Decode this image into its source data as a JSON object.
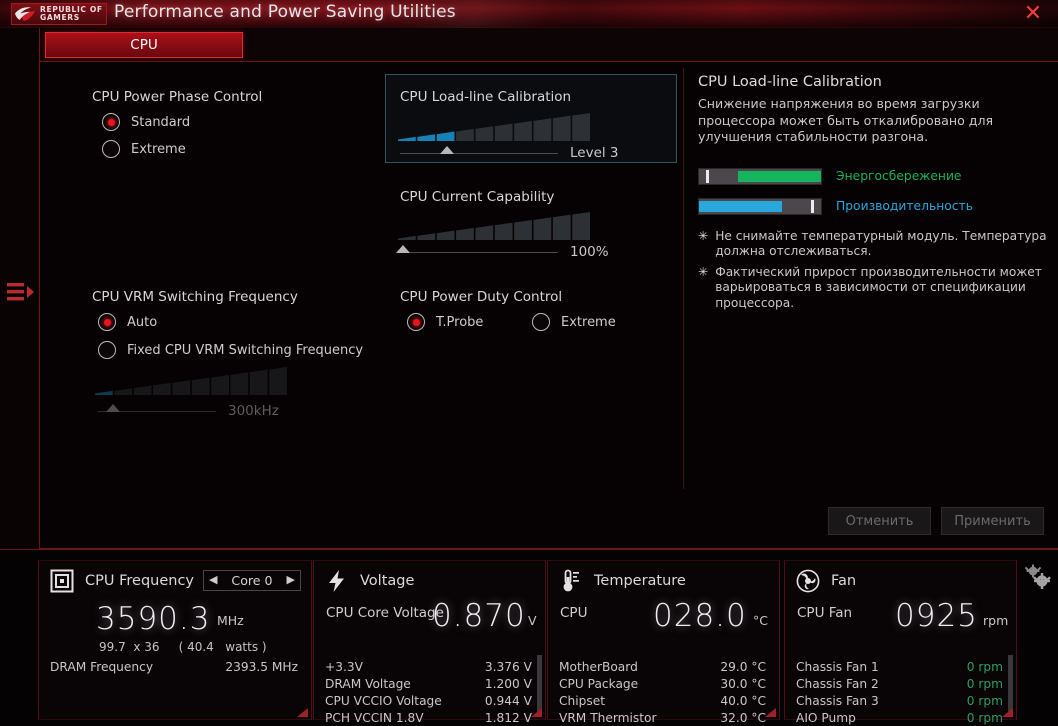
{
  "window": {
    "brand_line1": "REPUBLIC OF",
    "brand_line2": "GAMERS",
    "title": "Performance and Power Saving Utilities",
    "close_label": "✕",
    "rail_toggle_icon": "menu-expand-icon"
  },
  "tabs": [
    {
      "label": "CPU",
      "active": true
    }
  ],
  "form": {
    "power_phase": {
      "label": "CPU Power Phase Control",
      "options": [
        {
          "label": "Standard",
          "selected": true
        },
        {
          "label": "Extreme",
          "selected": false
        }
      ]
    },
    "vrm_switching": {
      "label": "CPU VRM Switching Frequency",
      "options": [
        {
          "label": "Auto",
          "selected": true
        },
        {
          "label": "Fixed CPU VRM Switching Frequency",
          "selected": false
        }
      ],
      "slider_value": "300kHz",
      "segments_total": 10,
      "segments_filled": 1,
      "thumb_percent": 13,
      "disabled": true
    },
    "llc": {
      "label": "CPU Load-line Calibration",
      "slider_value": "Level 3",
      "segments_total": 10,
      "segments_filled": 3,
      "thumb_percent": 30,
      "highlighted": true,
      "fill_color": "#1583b5"
    },
    "current_capability": {
      "label": "CPU Current Capability",
      "slider_value": "100%",
      "segments_total": 10,
      "segments_filled": 0,
      "thumb_percent": 2
    },
    "duty_control": {
      "label": "CPU Power Duty Control",
      "options": [
        {
          "label": "T.Probe",
          "selected": true
        },
        {
          "label": "Extreme",
          "selected": false
        }
      ]
    }
  },
  "help": {
    "title": "CPU Load-line Calibration",
    "body": "Снижение напряжения во время загрузки процессора может быть откалибровано для улучшения стабильности разгона.",
    "meters": [
      {
        "label": "Энергосбережение",
        "color": "#17b45e",
        "fill_start_pct": 32,
        "fill_end_pct": 100,
        "mark_pct": 6
      },
      {
        "label": "Производительность",
        "color": "#29a8dd",
        "fill_start_pct": 0,
        "fill_end_pct": 68,
        "mark_pct": 92
      }
    ],
    "notes": [
      "Не снимайте температурный модуль. Температура должна отслеживаться.",
      "Фактический прирост производительности может варьироваться в зависимости от спецификации процессора."
    ],
    "star": "✳"
  },
  "actions": {
    "cancel_label": "Отменить",
    "apply_label": "Применить"
  },
  "monitors": {
    "cpu_frequency": {
      "icon": "cpu-icon",
      "title": "CPU Frequency",
      "core_selector": {
        "value": "Core 0",
        "prev": "◀",
        "next": "▶"
      },
      "big_value": "3590.3",
      "big_unit": "MHz",
      "sub_line": "99.7  x 36     ( 40.4   watts )",
      "rows": [
        {
          "label": "DRAM Frequency",
          "value": "2393.5  MHz"
        }
      ]
    },
    "voltage": {
      "icon": "bolt-icon",
      "title": "Voltage",
      "big_label": "CPU Core Voltage",
      "big_value": "0.870",
      "big_unit": "V",
      "rows": [
        {
          "label": "+3.3V",
          "value": "3.376  V"
        },
        {
          "label": "DRAM Voltage",
          "value": "1.200  V"
        },
        {
          "label": "CPU VCCIO Voltage",
          "value": "0.944  V"
        },
        {
          "label": "PCH VCCIN 1.8V",
          "value": "1.812  V"
        }
      ],
      "has_scrollbar": true
    },
    "temperature": {
      "icon": "thermometer-icon",
      "title": "Temperature",
      "big_label": "CPU",
      "big_value": "028.0",
      "big_unit": "°C",
      "rows": [
        {
          "label": "MotherBoard",
          "value": "29.0 °C"
        },
        {
          "label": "CPU Package",
          "value": "30.0 °C"
        },
        {
          "label": "Chipset",
          "value": "40.0 °C"
        },
        {
          "label": "VRM Thermistor",
          "value": "32.0 °C"
        }
      ],
      "has_scrollbar": false
    },
    "fan": {
      "icon": "fan-icon",
      "title": "Fan",
      "big_label": "CPU Fan",
      "big_value": "0925",
      "big_unit": "rpm",
      "rows": [
        {
          "label": "Chassis Fan 1",
          "value": "0  rpm"
        },
        {
          "label": "Chassis Fan 2",
          "value": "0  rpm"
        },
        {
          "label": "Chassis Fan 3",
          "value": "0  rpm"
        },
        {
          "label": "AIO Pump",
          "value": "0  rpm"
        }
      ],
      "value_color": "green",
      "has_scrollbar": true
    },
    "settings_icon": "gears-icon"
  }
}
